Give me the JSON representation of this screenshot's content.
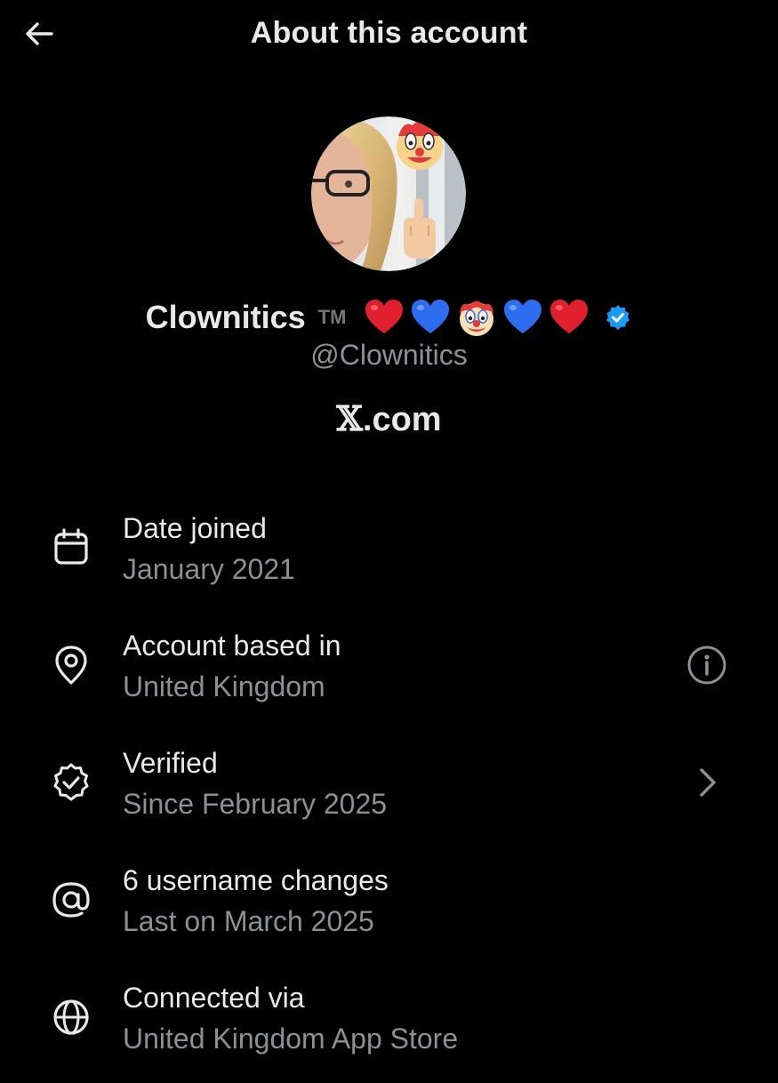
{
  "header": {
    "title": "About this account",
    "back_icon": "back-arrow-icon"
  },
  "profile": {
    "display_name": "Clownitics",
    "trademark": "TM",
    "name_emojis": [
      "red-heart",
      "blue-heart",
      "clown-face",
      "blue-heart",
      "red-heart"
    ],
    "verified": true,
    "handle": "@Clownitics",
    "website_mark": "𝕏",
    "website_rest": ".com"
  },
  "details": [
    {
      "icon": "calendar-icon",
      "title": "Date joined",
      "subtitle": "January 2021",
      "trailing": null
    },
    {
      "icon": "location-pin-icon",
      "title": "Account based in",
      "subtitle": "United Kingdom",
      "trailing": "info-icon"
    },
    {
      "icon": "verified-badge-icon",
      "title": "Verified",
      "subtitle": "Since February 2025",
      "trailing": "chevron-right-icon"
    },
    {
      "icon": "at-sign-icon",
      "title": "6 username changes",
      "subtitle": "Last on March 2025",
      "trailing": null
    },
    {
      "icon": "globe-icon",
      "title": "Connected via",
      "subtitle": "United Kingdom App Store",
      "trailing": null
    }
  ],
  "colors": {
    "background": "#000000",
    "primary_text": "#e7e9ea",
    "secondary_text": "#8b9095",
    "verified_blue": "#1d9bf0",
    "heart_red": "#e0202e",
    "heart_blue": "#2f6df0"
  }
}
